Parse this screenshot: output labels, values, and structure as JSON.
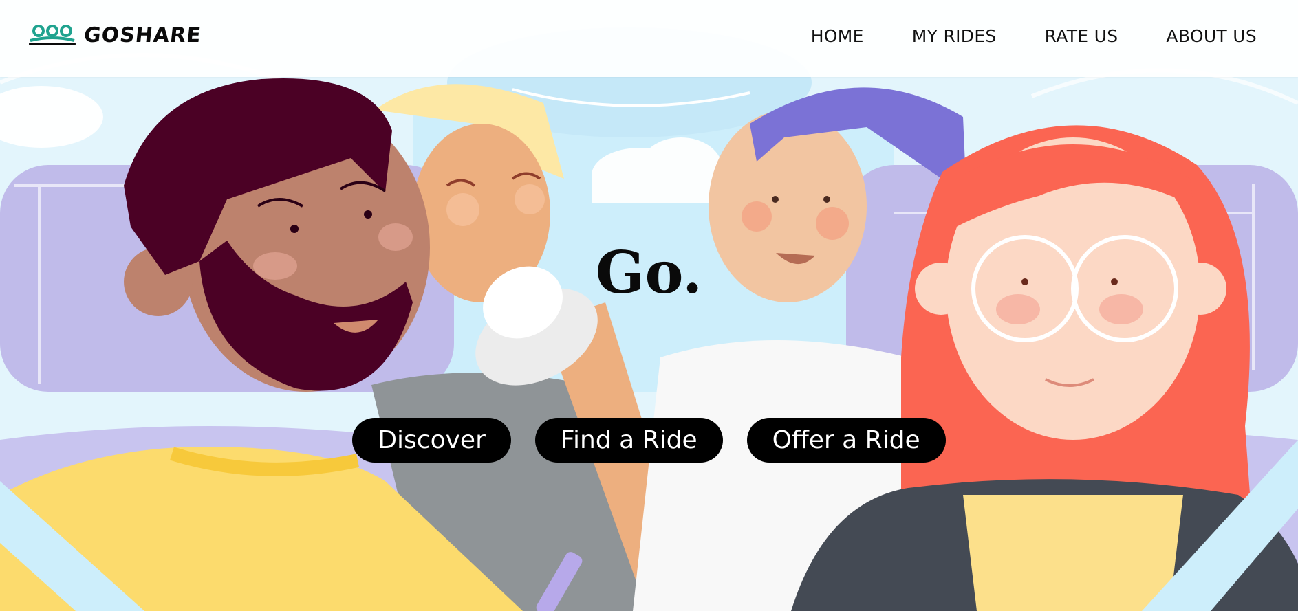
{
  "brand": {
    "name": "GOSHARE",
    "logo_color": "#1fa38f"
  },
  "nav": {
    "items": [
      {
        "label": "HOME"
      },
      {
        "label": "MY RIDES"
      },
      {
        "label": "RATE US"
      },
      {
        "label": "ABOUT US"
      }
    ]
  },
  "hero": {
    "title": "Go.",
    "buttons": [
      {
        "label": "Discover"
      },
      {
        "label": "Find a Ride"
      },
      {
        "label": "Offer a Ride"
      }
    ],
    "illustration": "four-passengers-in-car",
    "palette": {
      "sky": "#dff3fb",
      "seat": "#c0bbea",
      "beard_man_hair": "#4b0125",
      "beard_man_skin": "#bd826d",
      "yellow_shirt": "#fcdb6d",
      "red_hair": "#fb6552",
      "purple_hair": "#7b72d6",
      "dark_jacket": "#444a54"
    }
  }
}
